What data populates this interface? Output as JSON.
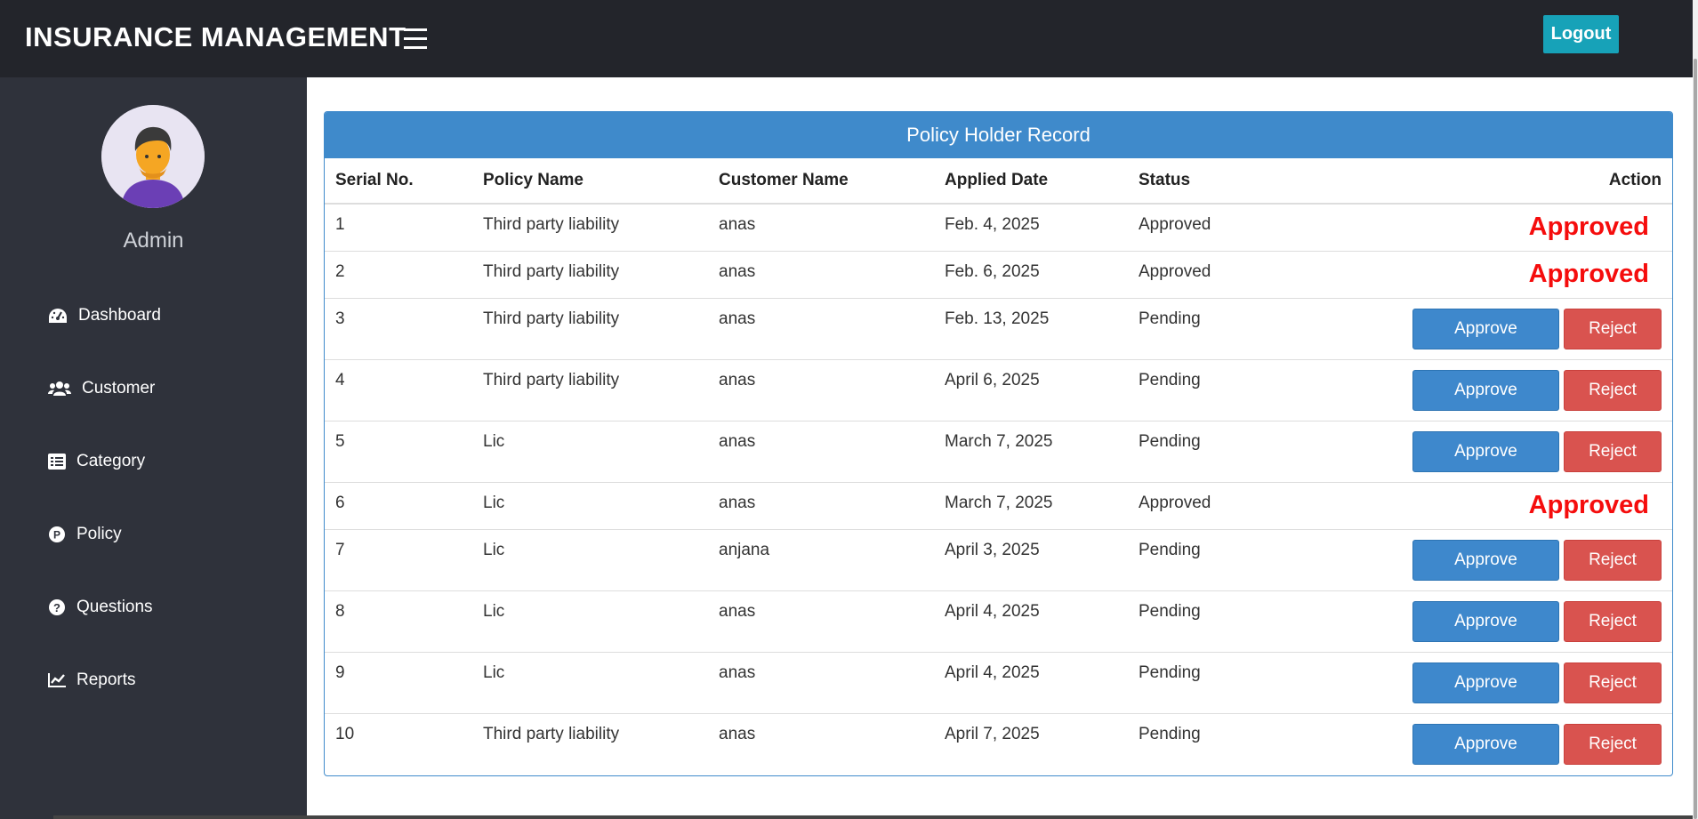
{
  "header": {
    "brand": "INSURANCE MANAGEMENT",
    "logout_label": "Logout"
  },
  "sidebar": {
    "user_name": "Admin",
    "items": [
      {
        "label": "Dashboard",
        "icon": "tachometer-icon"
      },
      {
        "label": "Customer",
        "icon": "users-icon"
      },
      {
        "label": "Category",
        "icon": "list-icon"
      },
      {
        "label": "Policy",
        "icon": "policy-p-icon"
      },
      {
        "label": "Questions",
        "icon": "question-circle-icon"
      },
      {
        "label": "Reports",
        "icon": "line-chart-icon"
      }
    ]
  },
  "panel": {
    "title": "Policy Holder Record",
    "columns": [
      "Serial No.",
      "Policy Name",
      "Customer Name",
      "Applied Date",
      "Status",
      "Action"
    ],
    "approve_label": "Approve",
    "reject_label": "Reject",
    "approved_label": "Approved",
    "rows": [
      {
        "serial": "1",
        "policy": "Third party liability",
        "customer": "anas",
        "date": "Feb. 4, 2025",
        "status": "Approved"
      },
      {
        "serial": "2",
        "policy": "Third party liability",
        "customer": "anas",
        "date": "Feb. 6, 2025",
        "status": "Approved"
      },
      {
        "serial": "3",
        "policy": "Third party liability",
        "customer": "anas",
        "date": "Feb. 13, 2025",
        "status": "Pending"
      },
      {
        "serial": "4",
        "policy": "Third party liability",
        "customer": "anas",
        "date": "April 6, 2025",
        "status": "Pending"
      },
      {
        "serial": "5",
        "policy": "Lic",
        "customer": "anas",
        "date": "March 7, 2025",
        "status": "Pending"
      },
      {
        "serial": "6",
        "policy": "Lic",
        "customer": "anas",
        "date": "March 7, 2025",
        "status": "Approved"
      },
      {
        "serial": "7",
        "policy": "Lic",
        "customer": "anjana",
        "date": "April 3, 2025",
        "status": "Pending"
      },
      {
        "serial": "8",
        "policy": "Lic",
        "customer": "anas",
        "date": "April 4, 2025",
        "status": "Pending"
      },
      {
        "serial": "9",
        "policy": "Lic",
        "customer": "anas",
        "date": "April 4, 2025",
        "status": "Pending"
      },
      {
        "serial": "10",
        "policy": "Third party liability",
        "customer": "anas",
        "date": "April 7, 2025",
        "status": "Pending"
      }
    ]
  },
  "colors": {
    "topbar": "#23252b",
    "sidebar": "#2f323b",
    "accent_blue": "#3f8acb",
    "logout_teal": "#17a2b8",
    "reject_red": "#d9534f",
    "approved_text_red": "#f50d0d"
  }
}
